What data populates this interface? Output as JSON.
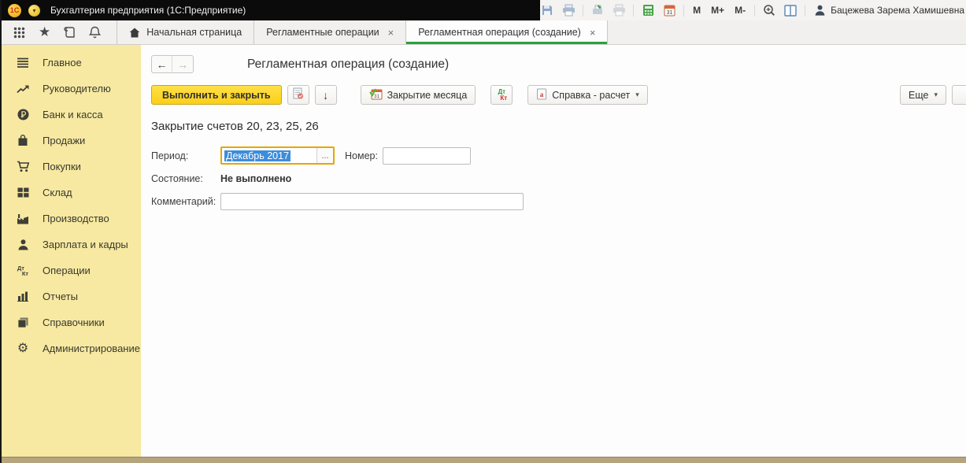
{
  "titlebar": {
    "logo_text": "1С",
    "app_title": "Бухгалтерия предприятия   (1С:Предприятие)",
    "user_name": "Бацежева Зарема Хамишевна",
    "memory": {
      "m": "M",
      "m_plus": "M+",
      "m_minus": "M-"
    }
  },
  "tabbar": {
    "tabs": [
      {
        "label": "Начальная страница"
      },
      {
        "label": "Регламентные операции"
      },
      {
        "label": "Регламентная операция (создание)"
      }
    ]
  },
  "sidebar": {
    "items": [
      {
        "label": "Главное"
      },
      {
        "label": "Руководителю"
      },
      {
        "label": "Банк и касса"
      },
      {
        "label": "Продажи"
      },
      {
        "label": "Покупки"
      },
      {
        "label": "Склад"
      },
      {
        "label": "Производство"
      },
      {
        "label": "Зарплата и кадры"
      },
      {
        "label": "Операции"
      },
      {
        "label": "Отчеты"
      },
      {
        "label": "Справочники"
      },
      {
        "label": "Администрирование"
      }
    ]
  },
  "main": {
    "page_title": "Регламентная операция (создание)",
    "toolbar": {
      "execute_close": "Выполнить и закрыть",
      "month_close": "Закрытие месяца",
      "help_calc": "Справка - расчет",
      "more": "Еще"
    },
    "heading": "Закрытие счетов 20, 23, 25, 26",
    "form": {
      "period_label": "Период:",
      "period_value": "Декабрь 2017",
      "number_label": "Номер:",
      "number_value": "",
      "state_label": "Состояние:",
      "state_value": "Не выполнено",
      "comment_label": "Комментарий:",
      "comment_value": ""
    }
  },
  "glyphs": {
    "close": "×",
    "caret": "▾",
    "back": "←",
    "forward": "→",
    "down": "↓",
    "star": "★",
    "gear": "⚙",
    "ellipsis": "...",
    "calendar_day": "31",
    "dt": "Дт",
    "kt": "Кт",
    "menu_caret": "▾"
  },
  "colors": {
    "accent_green": "#28a23c",
    "sidebar_yellow": "#f7e9a1",
    "button_yellow": "#fccf17",
    "selection_blue": "#3c8ddc",
    "focus_orange": "#e7a600",
    "titlebar_black": "#0b0b0b",
    "bottom_strip": "#b5a47e"
  }
}
